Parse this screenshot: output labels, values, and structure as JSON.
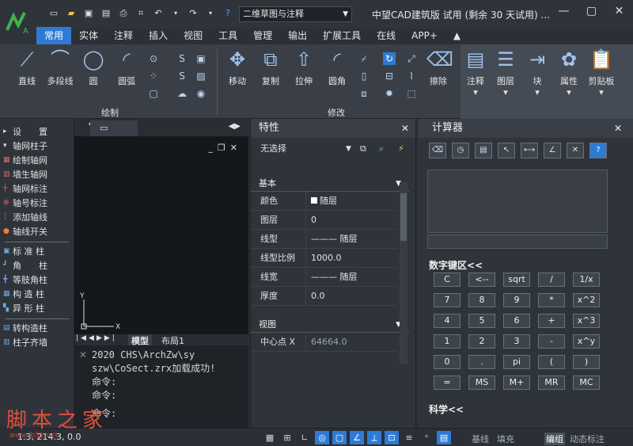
{
  "app": {
    "title": "中望CAD建筑版 试用 (剩余 30 天试用) ...",
    "workspace": "二维草图与注释"
  },
  "window_controls": [
    "—",
    "▢",
    "✕"
  ],
  "tabs": [
    "常用",
    "实体",
    "注释",
    "插入",
    "视图",
    "工具",
    "管理",
    "输出",
    "扩展工具",
    "在线",
    "APP+"
  ],
  "ribbon": {
    "draw": {
      "label": "绘制",
      "items": [
        "直线",
        "多段线",
        "圆",
        "圆弧"
      ]
    },
    "modify": {
      "label": "修改",
      "items": [
        "移动",
        "复制",
        "拉伸",
        "圆角",
        "擦除"
      ]
    },
    "right": [
      "注释",
      "图层",
      "块",
      "属性",
      "剪贴板"
    ]
  },
  "left_panel": {
    "items": [
      "设　　置",
      "轴网柱子",
      "绘制轴网",
      "墙生轴网",
      "轴网标注",
      "轴号标注",
      "添加轴线",
      "轴线开关",
      "标 准 柱",
      "角　　柱",
      "等肢角柱",
      "构 造 柱",
      "异 形 柱",
      "转构造柱",
      "柱子齐墙"
    ]
  },
  "drawing": {
    "model_tab": "模型",
    "layout_tab": "布局1",
    "axis_x": "X",
    "axis_y": "Y"
  },
  "command": {
    "lines": [
      "2020 CHS\\ArchZw\\sy",
      "szw\\CoSect.zrx加载成功!",
      "命令:",
      "命令:",
      "命令:"
    ]
  },
  "properties": {
    "title": "特性",
    "selection": "无选择",
    "basic_label": "基本",
    "rows": [
      {
        "k": "颜色",
        "v": "随层"
      },
      {
        "k": "图层",
        "v": "0"
      },
      {
        "k": "线型",
        "v": "——— 随层"
      },
      {
        "k": "线型比例",
        "v": "1000.0"
      },
      {
        "k": "线宽",
        "v": "——— 随层"
      },
      {
        "k": "厚度",
        "v": "0.0"
      }
    ],
    "view_label": "视图",
    "view_rows": [
      {
        "k": "中心点 X",
        "v": "64664.0"
      }
    ]
  },
  "calculator": {
    "title": "计算器",
    "numpad_label": "数字键区<<",
    "keys": [
      "C",
      "<--",
      "sqrt",
      "/",
      "1/x",
      "7",
      "8",
      "9",
      "*",
      "x^2",
      "4",
      "5",
      "6",
      "+",
      "x^3",
      "1",
      "2",
      "3",
      "-",
      "x^y",
      "0",
      ".",
      "pi",
      "(",
      ")",
      "=",
      "MS",
      "M+",
      "MR",
      "MC"
    ],
    "sci_label": "科学<<"
  },
  "status": {
    "coord": "1.3, 214.3, 0.0",
    "texts": [
      "基线",
      "填充",
      "编组",
      "动态标注"
    ]
  },
  "watermark": {
    "text": "脚本之家",
    "url": "www.jb51.net"
  },
  "colors": {
    "accent": "#2e7bd6",
    "bg": "#2b2f36",
    "panel": "#2f343b"
  }
}
